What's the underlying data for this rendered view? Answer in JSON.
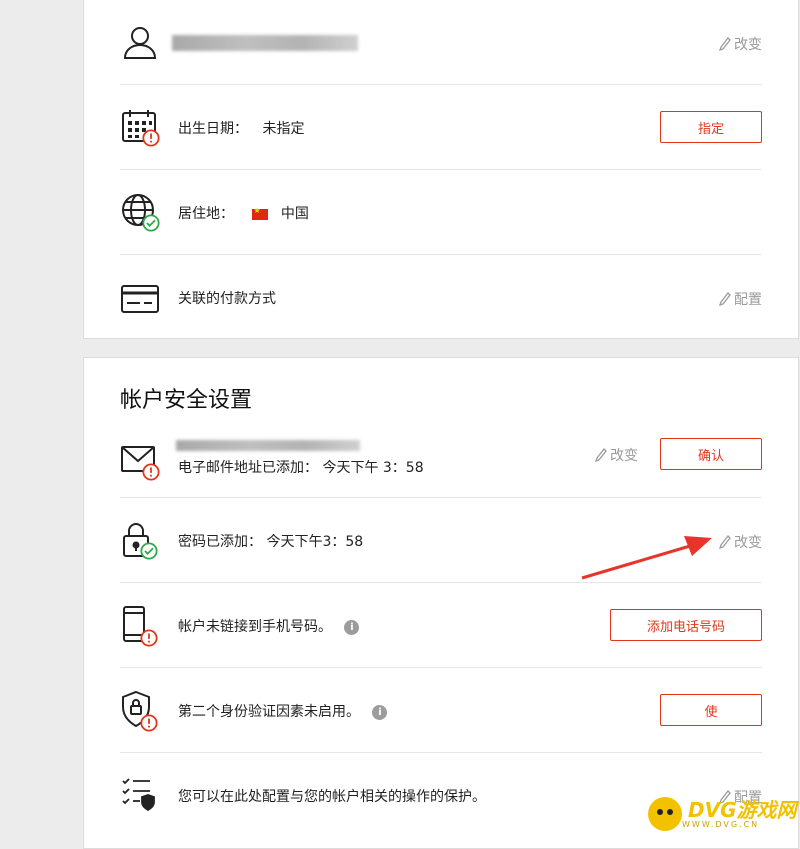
{
  "profile": {
    "name_edit": "改变",
    "birthday": {
      "label": "出生日期：",
      "value": "未指定",
      "button": "指定"
    },
    "residence": {
      "label": "居住地：",
      "value": "中国"
    },
    "payment": {
      "label": "关联的付款方式",
      "action": "配置"
    }
  },
  "security": {
    "title": "帐户安全设置",
    "email": {
      "text": "电子邮件地址已添加：  今天下午 3：58",
      "edit": "改变",
      "button": "确认"
    },
    "password": {
      "text": "密码已添加：  今天下午3：58",
      "edit": "改变"
    },
    "phone": {
      "text": "帐户未链接到手机号码。",
      "button": "添加电话号码"
    },
    "twofactor": {
      "text": "第二个身份验证因素未启用。",
      "button": "使"
    },
    "protection": {
      "text": "您可以在此处配置与您的帐户相关的操作的保护。",
      "action": "配置"
    }
  },
  "colors": {
    "accent": "#e2361b",
    "warning": "#e2361b",
    "ok": "#2ea84a"
  },
  "watermark": {
    "brand": "DVG游戏网",
    "sub": "WWW.DVG.CN"
  }
}
